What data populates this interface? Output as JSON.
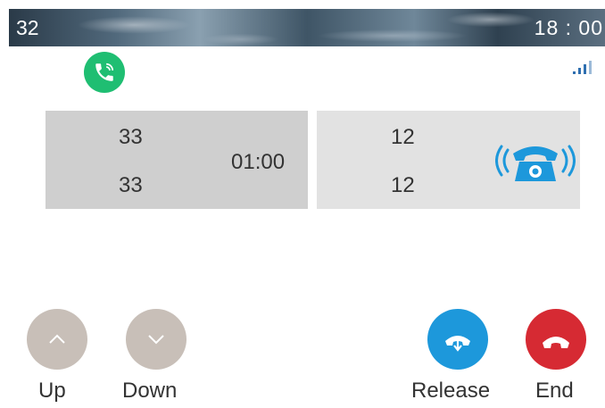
{
  "status_bar": {
    "account": "32",
    "time": "18 : 00"
  },
  "call": {
    "left_panel": {
      "number_top": "33",
      "number_bottom": "33",
      "duration": "01:00"
    },
    "right_panel": {
      "number_top": "12",
      "number_bottom": "12",
      "state_icon": "phone-ringing-icon"
    },
    "colors": {
      "active_call": "#1fbe72",
      "hold_icon": "#1d98db"
    }
  },
  "softkeys": [
    {
      "label": "Up",
      "icon": "chevron-up-icon",
      "color": "#c8bfb8"
    },
    {
      "label": "Down",
      "icon": "chevron-down-icon",
      "color": "#c8bfb8"
    },
    {
      "label": "Release",
      "icon": "handset-down-arrow-icon",
      "color": "#1d98db"
    },
    {
      "label": "End",
      "icon": "hangup-icon",
      "color": "#d62a33"
    }
  ]
}
